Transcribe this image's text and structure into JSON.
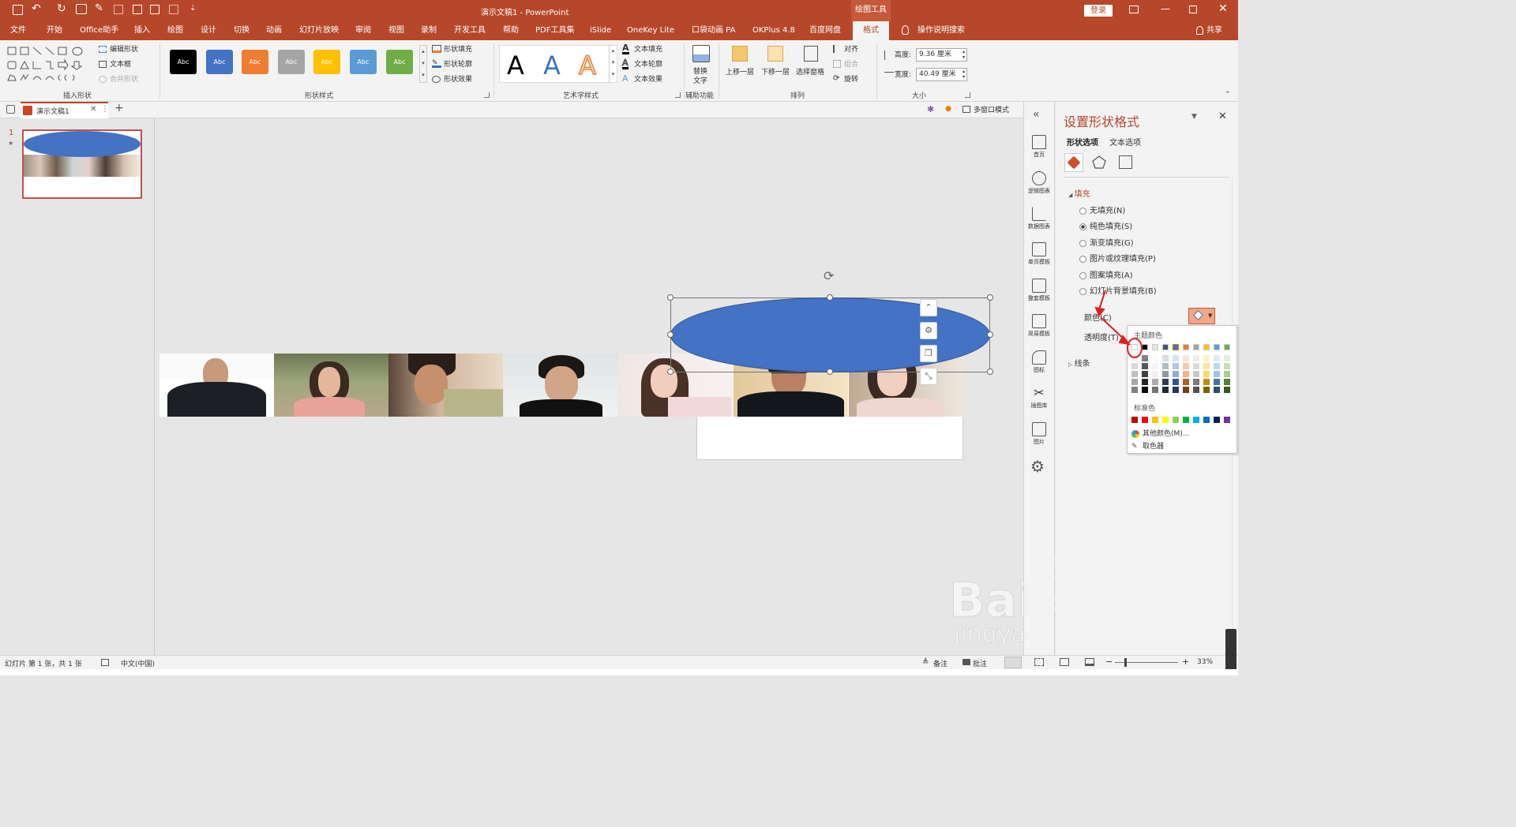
{
  "titlebar": {
    "title": "演示文稿1  -  PowerPoint",
    "context_tab": "绘图工具",
    "login": "登录"
  },
  "tabs": [
    "文件",
    "开始",
    "Office助手",
    "插入",
    "绘图",
    "设计",
    "切换",
    "动画",
    "幻灯片放映",
    "审阅",
    "视图",
    "录制",
    "开发工具",
    "帮助",
    "PDF工具集",
    "iSlide",
    "OneKey Lite",
    "口袋动画 PA",
    "OKPlus 4.8",
    "百度网盘",
    "格式"
  ],
  "tell_me": "操作说明搜索",
  "share": "共享",
  "ribbon": {
    "insert_shapes": {
      "label": "插入形状",
      "edit_shape": "编辑形状",
      "textbox": "文本框",
      "merge_shapes": "合并形状"
    },
    "shape_styles": {
      "label": "形状样式",
      "swatch_text": "Abc",
      "fill": "形状填充",
      "outline": "形状轮廓",
      "effects": "形状效果",
      "colors": [
        "#000000",
        "#4472c4",
        "#ed7d31",
        "#a5a5a5",
        "#ffc000",
        "#5b9bd5",
        "#70ad47"
      ]
    },
    "wordart": {
      "label": "艺术字样式",
      "letter": "A",
      "text_fill": "文本填充",
      "text_outline": "文本轮廓",
      "text_effects": "文本效果"
    },
    "accessibility": {
      "label": "辅助功能",
      "alt_text_1": "替换",
      "alt_text_2": "文字"
    },
    "arrange": {
      "label": "排列",
      "bring_forward": "上移一层",
      "send_backward": "下移一层",
      "selection_pane": "选择窗格",
      "align": "对齐",
      "group": "组合",
      "rotate": "旋转"
    },
    "size": {
      "label": "大小",
      "height_label": "高度:",
      "height_value": "9.36 厘米",
      "width_label": "宽度:",
      "width_value": "40.49 厘米"
    }
  },
  "docbar": {
    "doc_tab": "演示文稿1",
    "multi_window": "多窗口模式"
  },
  "thumbnail": {
    "number": "1",
    "star": "*"
  },
  "sidebar": [
    "首页",
    "逻辑图表",
    "数据图表",
    "单页模板",
    "整套模板",
    "简易模板",
    "图标",
    "插图库",
    "图片"
  ],
  "pane": {
    "title": "设置形状格式",
    "tab_shape": "形状选项",
    "tab_text": "文本选项",
    "fill_section": "填充",
    "options": [
      "无填充(N)",
      "纯色填充(S)",
      "渐变填充(G)",
      "图片或纹理填充(P)",
      "图案填充(A)",
      "幻灯片背景填充(B)"
    ],
    "selected_option": "纯色填充(S)",
    "color_label": "颜色(C)",
    "transparency_label": "透明度(T)",
    "line_section": "线条"
  },
  "color_picker": {
    "theme_title": "主题颜色",
    "theme_colors": [
      "#ffffff",
      "#000000",
      "#e7e6e6",
      "#44546a",
      "#4472c4",
      "#ed7d31",
      "#a5a5a5",
      "#ffc000",
      "#5b9bd5",
      "#70ad47"
    ],
    "standard_title": "标准色",
    "standard_colors": [
      "#c00000",
      "#ff0000",
      "#ffc000",
      "#ffff00",
      "#92d050",
      "#00b050",
      "#00b0f0",
      "#0070c0",
      "#002060",
      "#7030a0"
    ],
    "more_colors": "其他颜色(M)...",
    "eyedropper": "取色器"
  },
  "statusbar": {
    "slide_info": "幻灯片 第 1 张，共 1 张",
    "language": "中文(中国)",
    "notes": "备注",
    "comments": "批注",
    "zoom": "33%"
  },
  "watermark": {
    "brand": "Baidu经验",
    "url": "jingyan.baidu.com"
  }
}
